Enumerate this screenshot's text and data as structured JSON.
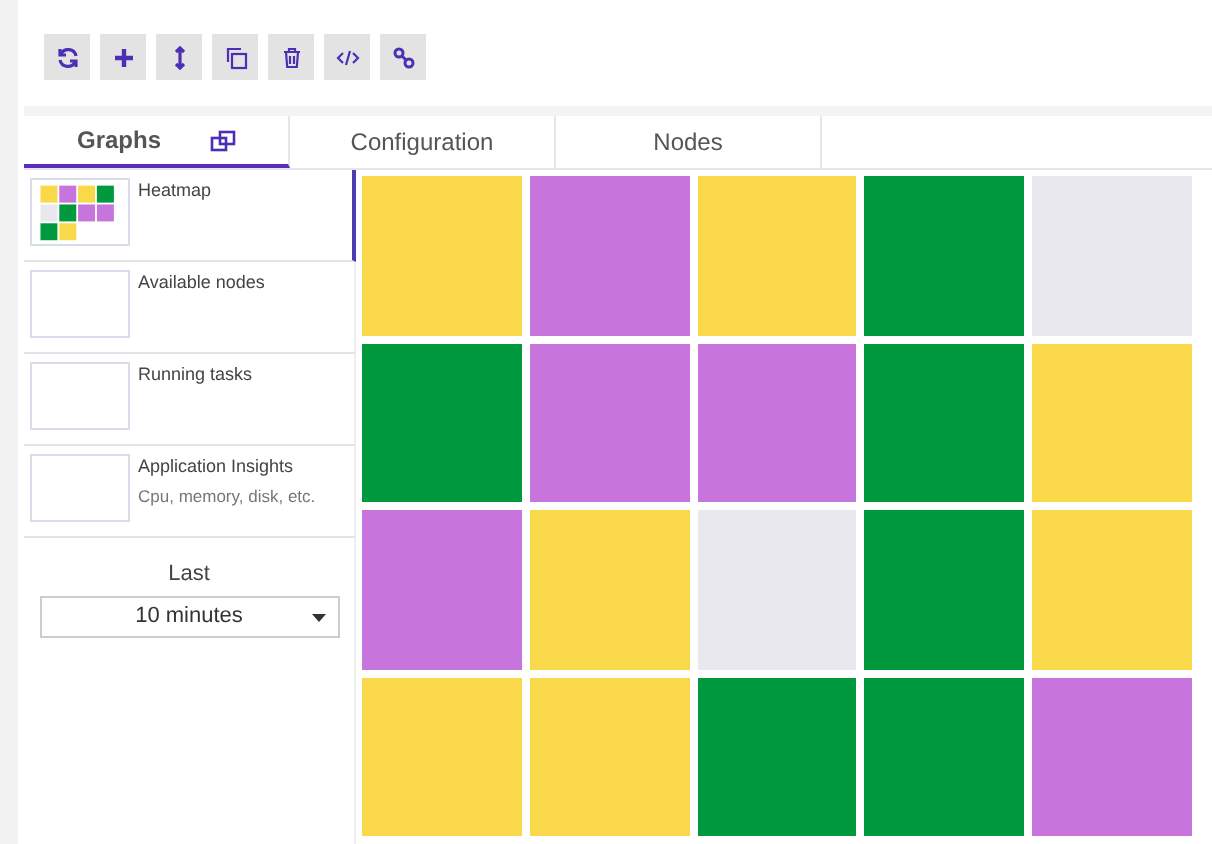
{
  "toolbar": [
    {
      "kind": "refresh"
    },
    {
      "kind": "add"
    },
    {
      "kind": "resize"
    },
    {
      "kind": "copy"
    },
    {
      "kind": "delete"
    },
    {
      "kind": "code"
    },
    {
      "kind": "link"
    }
  ],
  "tabs": [
    {
      "label": "Graphs",
      "selected": true,
      "kind": "popout"
    },
    {
      "label": "Configuration",
      "selected": false
    },
    {
      "label": "Nodes",
      "selected": false
    }
  ],
  "graphs": [
    {
      "title": "Heatmap",
      "selected": true,
      "kind": "heatmap"
    },
    {
      "title": "Available nodes",
      "selected": false
    },
    {
      "title": "Running tasks",
      "selected": false
    },
    {
      "title": "Application Insights",
      "subtitle": "Cpu, memory, disk, etc.",
      "selected": false
    }
  ],
  "time_range": {
    "label": "Last",
    "value": "10 minutes"
  },
  "heatmap": {
    "rows": [
      {
        "cells": [
          {
            "color": "#f9d949"
          },
          {
            "color": "#c774dc"
          },
          {
            "color": "#f9d949"
          },
          {
            "color": "#00993e"
          },
          {
            "color": "#e8e8ee"
          }
        ]
      },
      {
        "cells": [
          {
            "color": "#00993e"
          },
          {
            "color": "#c774dc"
          },
          {
            "color": "#c774dc"
          },
          {
            "color": "#00993e"
          },
          {
            "color": "#f9d949"
          }
        ]
      },
      {
        "cells": [
          {
            "color": "#c774dc"
          },
          {
            "color": "#f9d949"
          },
          {
            "color": "#e8e8ee"
          },
          {
            "color": "#00993e"
          },
          {
            "color": "#f9d949"
          }
        ]
      },
      {
        "cells": [
          {
            "color": "#f9d949"
          },
          {
            "color": "#f9d949"
          },
          {
            "color": "#00993e"
          },
          {
            "color": "#00993e"
          },
          {
            "color": "#c774dc"
          }
        ]
      }
    ]
  }
}
